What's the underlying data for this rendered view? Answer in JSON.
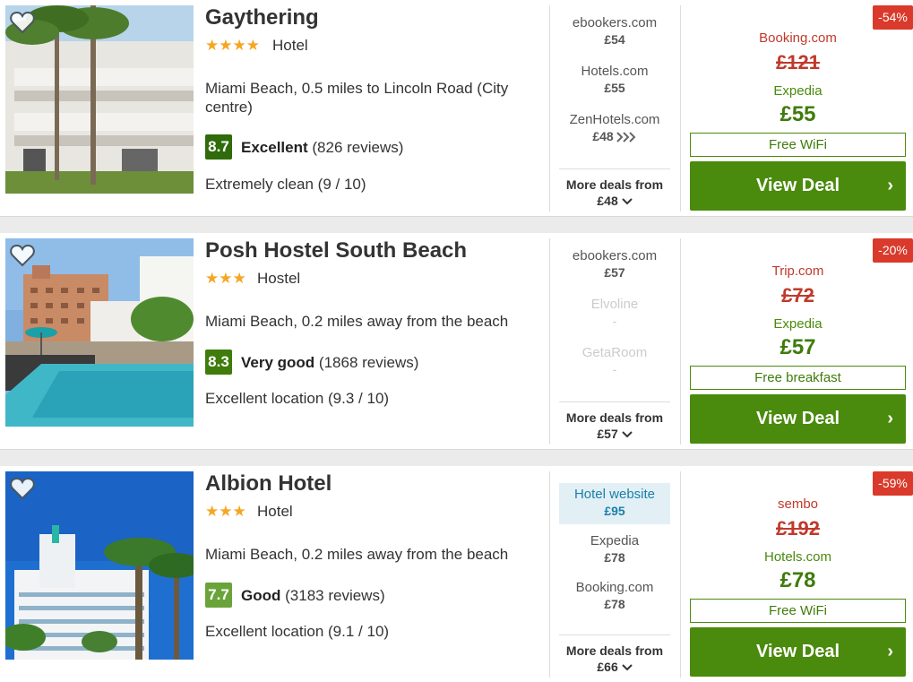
{
  "hotels": [
    {
      "name": "Gaythering",
      "stars": "★★★★",
      "type": "Hotel",
      "location": "Miami Beach, 0.5 miles to Lincoln Road (City centre)",
      "score": "8.7",
      "score_color": "#2f6b0a",
      "rating_label": "Excellent",
      "reviews": "(826 reviews)",
      "subrating": "Extremely clean (9 / 10)",
      "deals": [
        {
          "provider": "ebookers.com",
          "price": "£54"
        },
        {
          "provider": "Hotels.com",
          "price": "£55"
        },
        {
          "provider": "ZenHotels.com",
          "price": "£48"
        }
      ],
      "more_label": "More deals from",
      "more_price": "£48",
      "discount": "-54%",
      "old_provider": "Booking.com",
      "old_price": "£121",
      "new_provider": "Expedia",
      "new_price": "£55",
      "perk": "Free WiFi",
      "cta": "View Deal"
    },
    {
      "name": "Posh Hostel South Beach",
      "stars": "★★★",
      "type": "Hostel",
      "location": "Miami Beach, 0.2 miles away from the beach",
      "score": "8.3",
      "score_color": "#3f7c0b",
      "rating_label": "Very good",
      "reviews": "(1868 reviews)",
      "subrating": "Excellent location (9.3 / 10)",
      "deals": [
        {
          "provider": "ebookers.com",
          "price": "£57"
        },
        {
          "provider": "Elvoline",
          "price": "-"
        },
        {
          "provider": "GetaRoom",
          "price": "-"
        }
      ],
      "more_label": "More deals from",
      "more_price": "£57",
      "discount": "-20%",
      "old_provider": "Trip.com",
      "old_price": "£72",
      "new_provider": "Expedia",
      "new_price": "£57",
      "perk": "Free breakfast",
      "cta": "View Deal"
    },
    {
      "name": "Albion Hotel",
      "stars": "★★★",
      "type": "Hotel",
      "location": "Miami Beach, 0.2 miles away from the beach",
      "score": "7.7",
      "score_color": "#6aa33a",
      "rating_label": "Good",
      "reviews": "(3183 reviews)",
      "subrating": "Excellent location (9.1 / 10)",
      "deals": [
        {
          "provider": "Hotel website",
          "price": "£95"
        },
        {
          "provider": "Expedia",
          "price": "£78"
        },
        {
          "provider": "Booking.com",
          "price": "£78"
        }
      ],
      "more_label": "More deals from",
      "more_price": "£66",
      "discount": "-59%",
      "old_provider": "sembo",
      "old_price": "£192",
      "new_provider": "Hotels.com",
      "new_price": "£78",
      "perk": "Free WiFi",
      "cta": "View Deal"
    }
  ],
  "colors": {
    "deal_green": "#4a8a0c",
    "discount_red": "#d93a2b",
    "old_price_red": "#c0392b",
    "star_orange": "#f5a623"
  }
}
